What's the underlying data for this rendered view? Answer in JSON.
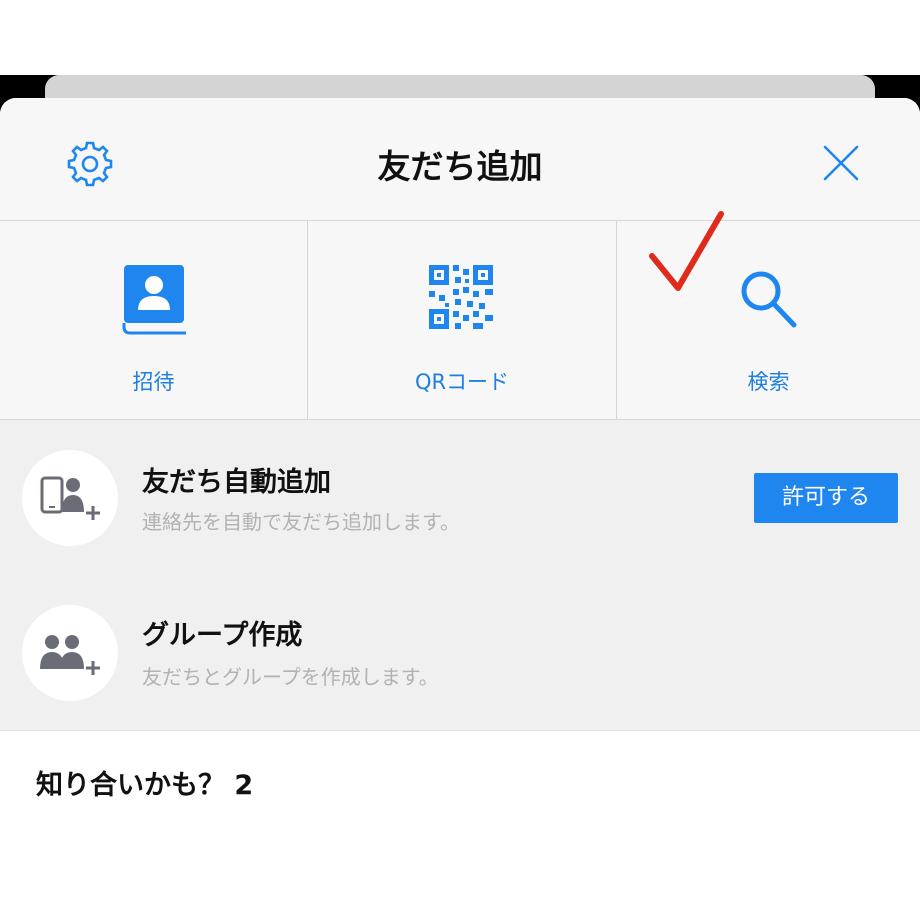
{
  "header": {
    "title": "友だち追加",
    "settings_icon": "gear-icon",
    "close_icon": "close-icon"
  },
  "tiles": [
    {
      "label": "招待",
      "icon": "contact-book-icon"
    },
    {
      "label": "QRコード",
      "icon": "qr-code-icon"
    },
    {
      "label": "検索",
      "icon": "search-icon"
    }
  ],
  "annotation": {
    "mark": "checkmark",
    "color": "#e02a1c"
  },
  "features": [
    {
      "title": "友だち自動追加",
      "subtitle": "連絡先を自動で友だち追加します。",
      "button": "許可する",
      "icon": "phone-friend-add-icon"
    },
    {
      "title": "グループ作成",
      "subtitle": "友だちとグループを作成します。",
      "icon": "group-add-icon"
    }
  ],
  "suggestions": {
    "title": "知り合いかも？ 2"
  },
  "colors": {
    "accent": "#1f86f0",
    "icon_gray": "#6b6d76"
  }
}
